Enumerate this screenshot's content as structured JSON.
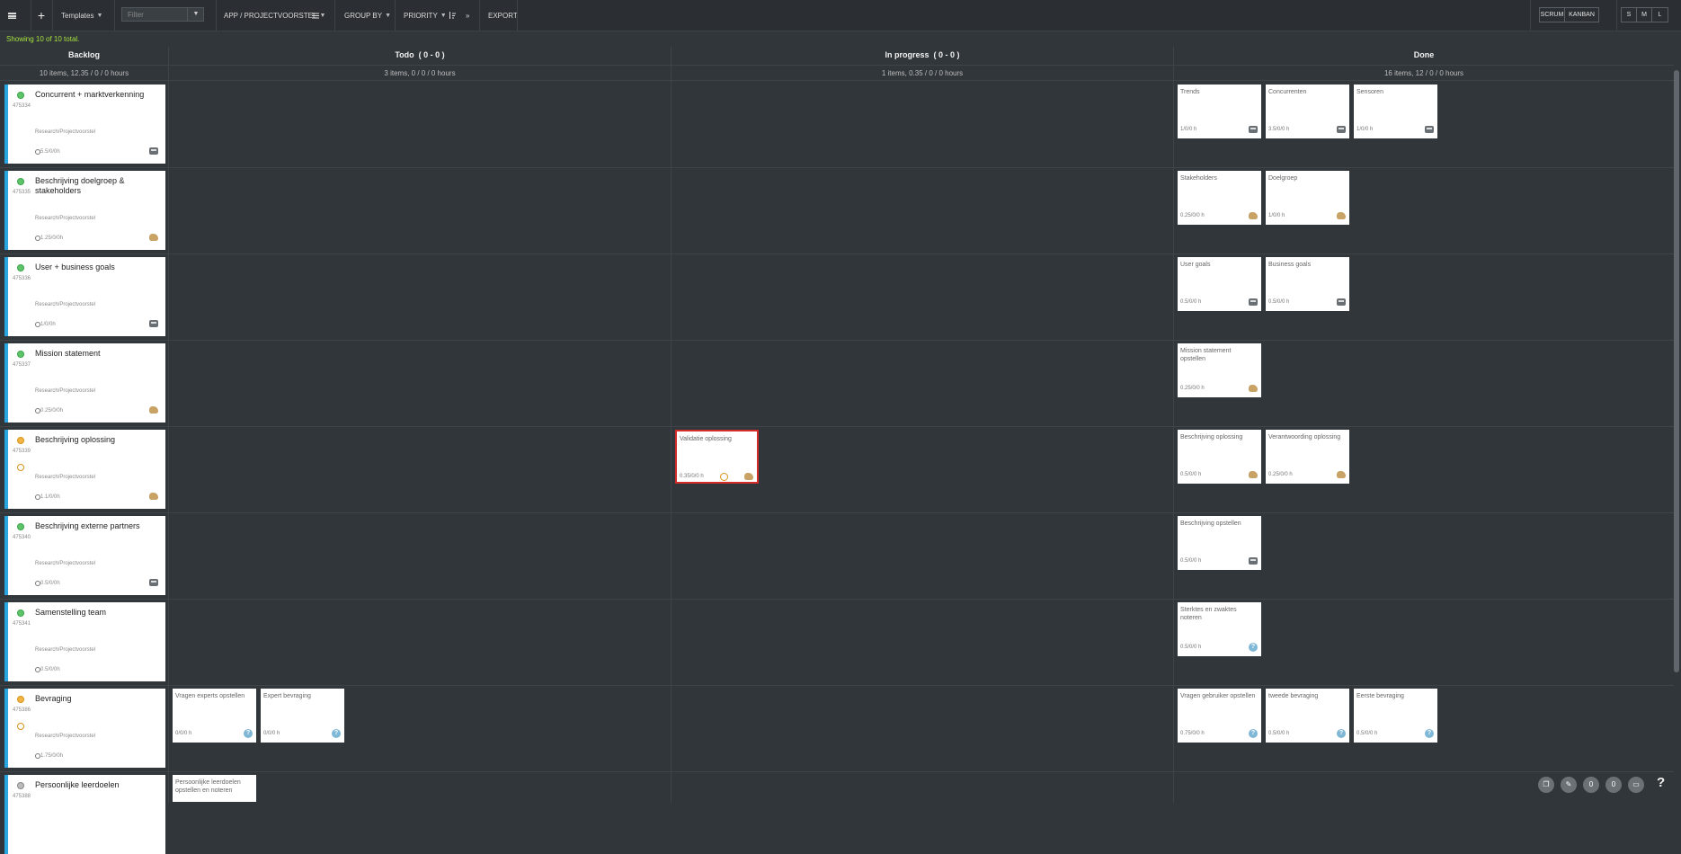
{
  "toolbar": {
    "templates_label": "Templates",
    "filter_placeholder": "Filter",
    "app_label": "APP / PROJECTVOORSTEL",
    "group_by_label": "GROUP BY",
    "priority_label": "PRIORITY",
    "more_label": "»",
    "export_label": "EXPORT",
    "view_modes": [
      "SCRUM",
      "KANBAN"
    ],
    "sizes": [
      "S",
      "M",
      "L"
    ]
  },
  "status_text": "Showing 10 of 10 total.",
  "columns": [
    {
      "title": "Backlog",
      "summary": "10 items, 12.35 / 0 / 0 hours"
    },
    {
      "title": "Todo  ( 0 - 0 )",
      "summary": "3 items, 0 / 0 / 0 hours"
    },
    {
      "title": "In progress  ( 0 - 0 )",
      "summary": "1 items, 0.35 / 0 / 0 hours"
    },
    {
      "title": "Done",
      "summary": "16 items, 12 / 0 / 0 hours"
    }
  ],
  "stories": [
    {
      "title": "Concurrent + marktverkenning",
      "id": "475334",
      "path": "Research/Projectvoorstel",
      "hours": "5.5/0/0h",
      "avatar": "robot-avatar",
      "dot": "green"
    },
    {
      "title": "Beschrijving doelgroep & stakeholders",
      "id": "475335",
      "path": "Research/Projectvoorstel",
      "hours": "1.25/0/0h",
      "avatar": "animal-avatar",
      "dot": "green"
    },
    {
      "title": "User + business goals",
      "id": "475336",
      "path": "Research/Projectvoorstel",
      "hours": "1/0/0h",
      "avatar": "robot-avatar",
      "dot": "green"
    },
    {
      "title": "Mission statement",
      "id": "475337",
      "path": "Research/Projectvoorstel",
      "hours": "0.25/0/0h",
      "avatar": "animal-avatar",
      "dot": "green"
    },
    {
      "title": "Beschrijving oplossing",
      "id": "475339",
      "path": "Research/Projectvoorstel",
      "hours": "1.1/0/0h",
      "avatar": "animal-avatar",
      "dot": "amber"
    },
    {
      "title": "Beschrijving externe partners",
      "id": "475340",
      "path": "Research/Projectvoorstel",
      "hours": "0.5/0/0h",
      "avatar": "robot-avatar",
      "dot": "green"
    },
    {
      "title": "Samenstelling team",
      "id": "475341",
      "path": "Research/Projectvoorstel",
      "hours": "0.5/0/0h",
      "avatar": "",
      "dot": "green"
    },
    {
      "title": "Bevraging",
      "id": "475386",
      "path": "Research/Projectvoorstel",
      "hours": "1.75/0/0h",
      "avatar": "",
      "dot": "amber"
    },
    {
      "title": "Persoonlijke leerdoelen",
      "id": "475388",
      "path": "",
      "hours": "",
      "avatar": "",
      "dot": "grey"
    }
  ],
  "tasks": {
    "todo": [
      {
        "row": 7,
        "slot": 0,
        "title": "Vragen experts opstellen",
        "hours": "0/0/0 h",
        "icon": "help-icon"
      },
      {
        "row": 7,
        "slot": 1,
        "title": "Expert bevraging",
        "hours": "0/0/0 h",
        "icon": "help-icon"
      },
      {
        "row": 8,
        "slot": 0,
        "title": "Persoonlijke leerdoelen opstellen en noteren",
        "hours": "",
        "icon": ""
      }
    ],
    "in_progress": [
      {
        "row": 4,
        "slot": 0,
        "title": "Validatie oplossing",
        "hours": "0.35/0/0 h",
        "icon": "animal-avatar",
        "blocked": true
      }
    ],
    "done": [
      {
        "row": 0,
        "slot": 0,
        "title": "Trends",
        "hours": "1/0/0 h",
        "icon": "robot-avatar"
      },
      {
        "row": 0,
        "slot": 1,
        "title": "Concurrenten",
        "hours": "3.5/0/0 h",
        "icon": "robot-avatar"
      },
      {
        "row": 0,
        "slot": 2,
        "title": "Sensoren",
        "hours": "1/0/0 h",
        "icon": "robot-avatar"
      },
      {
        "row": 1,
        "slot": 0,
        "title": "Stakeholders",
        "hours": "0.25/0/0 h",
        "icon": "animal-avatar"
      },
      {
        "row": 1,
        "slot": 1,
        "title": "Doelgroep",
        "hours": "1/0/0 h",
        "icon": "animal-avatar"
      },
      {
        "row": 2,
        "slot": 0,
        "title": "User goals",
        "hours": "0.5/0/0 h",
        "icon": "robot-avatar"
      },
      {
        "row": 2,
        "slot": 1,
        "title": "Business goals",
        "hours": "0.5/0/0 h",
        "icon": "robot-avatar"
      },
      {
        "row": 3,
        "slot": 0,
        "title": "Mission statement opstellen",
        "hours": "0.25/0/0 h",
        "icon": "animal-avatar"
      },
      {
        "row": 4,
        "slot": 0,
        "title": "Beschrijving oplossing",
        "hours": "0.5/0/0 h",
        "icon": "animal-avatar"
      },
      {
        "row": 4,
        "slot": 1,
        "title": "Verantwoording oplossing",
        "hours": "0.25/0/0 h",
        "icon": "animal-avatar"
      },
      {
        "row": 5,
        "slot": 0,
        "title": "Beschrijving opstellen",
        "hours": "0.5/0/0 h",
        "icon": "robot-avatar"
      },
      {
        "row": 6,
        "slot": 0,
        "title": "Sterktes en zwaktes noteren",
        "hours": "0.5/0/0 h",
        "icon": "help-icon"
      },
      {
        "row": 7,
        "slot": 0,
        "title": "Vragen gebruiker opstellen",
        "hours": "0.75/0/0 h",
        "icon": "help-icon"
      },
      {
        "row": 7,
        "slot": 1,
        "title": "tweede bevraging",
        "hours": "0.5/0/0 h",
        "icon": "help-icon"
      },
      {
        "row": 7,
        "slot": 2,
        "title": "Eerste bevraging",
        "hours": "0.5/0/0 h",
        "icon": "help-icon"
      }
    ]
  },
  "footer_badges": [
    "0",
    "0"
  ],
  "help_label": "?"
}
